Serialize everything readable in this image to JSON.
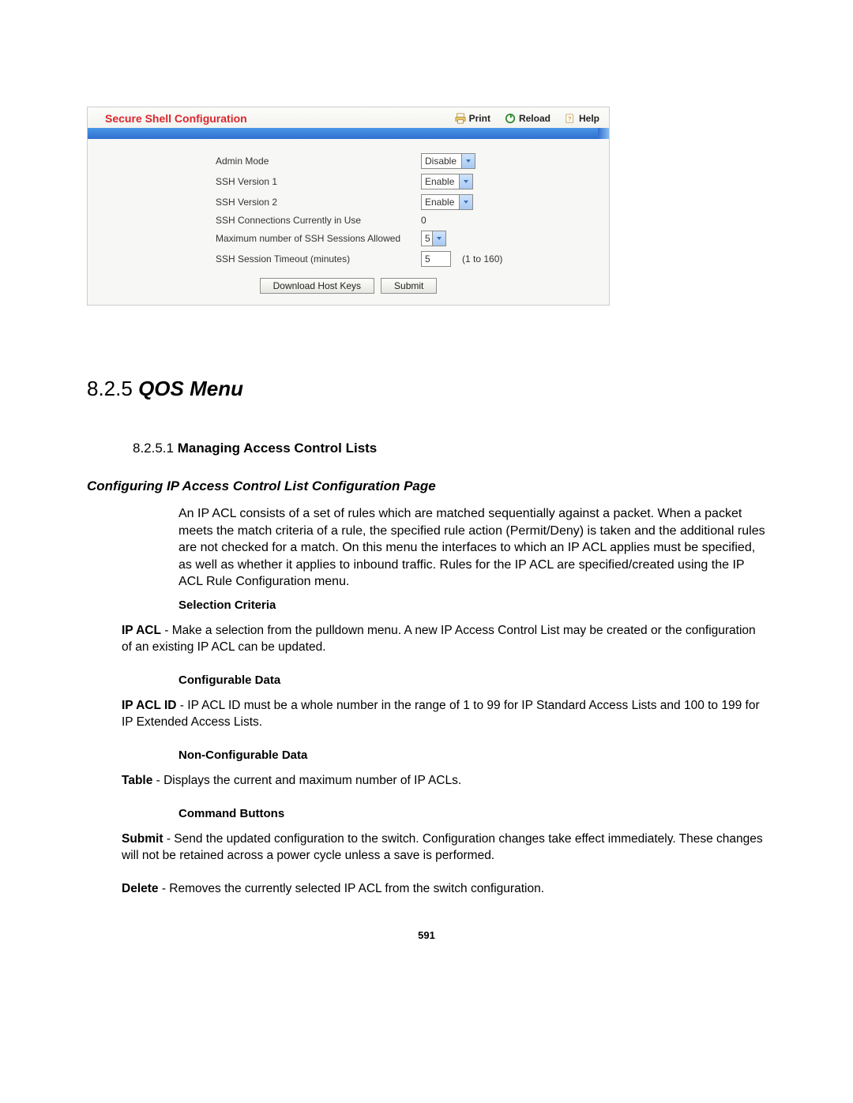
{
  "panel": {
    "title": "Secure Shell Configuration",
    "toolbar": {
      "print": "Print",
      "reload": "Reload",
      "help": "Help"
    },
    "rows": {
      "admin_mode": {
        "label": "Admin Mode",
        "value": "Disable"
      },
      "ssh_v1": {
        "label": "SSH Version 1",
        "value": "Enable"
      },
      "ssh_v2": {
        "label": "SSH Version 2",
        "value": "Enable"
      },
      "conns": {
        "label": "SSH Connections Currently in Use",
        "value": "0"
      },
      "max_sess": {
        "label": "Maximum number of SSH Sessions Allowed",
        "value": "5"
      },
      "timeout": {
        "label": "SSH Session Timeout (minutes)",
        "value": "5",
        "hint": "(1 to 160)"
      }
    },
    "buttons": {
      "download": "Download Host Keys",
      "submit": "Submit"
    }
  },
  "doc": {
    "section_num": "8.2.5",
    "section_title": "QOS Menu",
    "sub_num": "8.2.5.1",
    "sub_title": "Managing Access Control Lists",
    "config_heading": "Configuring IP Access Control List Configuration Page",
    "config_para": "An IP ACL consists of a set of rules which are matched sequentially against a packet. When a packet meets the match criteria of a rule, the specified rule action (Permit/Deny) is taken and the additional rules are not checked for a match. On this menu the interfaces to which an IP ACL applies must be specified, as well as whether it applies to inbound traffic. Rules for the IP ACL are specified/created using the IP ACL Rule Configuration menu.",
    "selection_label": "Selection Criteria",
    "ip_acl_term": "IP ACL",
    "ip_acl_desc": " - Make a selection from the pulldown menu. A new IP Access Control List may be created or the configuration of an existing IP ACL can be updated.",
    "configurable_label": "Configurable Data",
    "ip_acl_id_term": "IP ACL ID",
    "ip_acl_id_desc": " - IP ACL ID must be a whole number in the range of 1 to 99 for IP Standard Access Lists and 100 to 199 for IP Extended Access Lists.",
    "nonconfig_label": "Non-Configurable Data",
    "table_term": "Table",
    "table_desc": " - Displays the current and maximum number of IP ACLs.",
    "cmd_label": "Command Buttons",
    "submit_term": "Submit",
    "submit_desc": " - Send the updated configuration to the switch. Configuration changes take effect immediately. These changes will not be retained across a power cycle unless a save is performed.",
    "delete_term": "Delete",
    "delete_desc": " - Removes the currently selected IP ACL from the switch configuration.",
    "page_number": "591"
  }
}
